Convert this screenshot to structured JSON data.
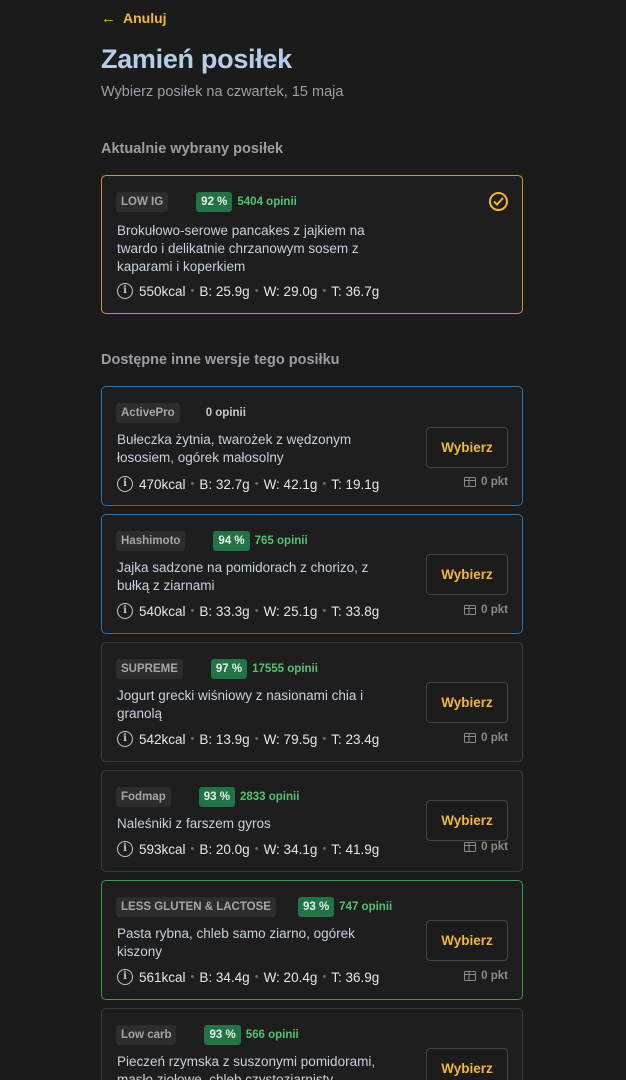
{
  "nav": {
    "back_label": "Anuluj"
  },
  "header": {
    "title": "Zamień posiłek",
    "subtitle": "Wybierz posiłek na czwartek, 15 maja"
  },
  "current_section": {
    "label": "Aktualnie wybrany posiłek",
    "meal": {
      "tag": "LOW IG",
      "rating": "92 %",
      "opinions": "5404 opinii",
      "name": "Brokułowo-serowe pancakes z jajkiem na twardo i delikatnie chrzanowym sosem z kaparami i koperkiem",
      "kcal": "550kcal",
      "protein": "B: 25.9g",
      "carbs": "W: 29.0g",
      "fat": "T: 36.7g"
    }
  },
  "alternatives_section": {
    "label": "Dostępne inne wersje tego posiłku",
    "choose_label": "Wybierz",
    "items": [
      {
        "tag": "ActivePro",
        "rating": "",
        "opinions": "0 opinii",
        "name": "Bułeczka żytnia, twarożek z wędzonym łososiem, ogórek małosolny",
        "kcal": "470kcal",
        "protein": "B: 32.7g",
        "carbs": "W: 42.1g",
        "fat": "T: 19.1g",
        "points": "0 pkt"
      },
      {
        "tag": "Hashimoto",
        "rating": "94 %",
        "opinions": "765 opinii",
        "name": "Jajka sadzone na pomidorach z chorizo, z bułką z ziarnami",
        "kcal": "540kcal",
        "protein": "B: 33.3g",
        "carbs": "W: 25.1g",
        "fat": "T: 33.8g",
        "points": "0 pkt"
      },
      {
        "tag": "SUPREME",
        "rating": "97 %",
        "opinions": "17555 opinii",
        "name": "Jogurt grecki wiśniowy z nasionami chia i granolą",
        "kcal": "542kcal",
        "protein": "B: 13.9g",
        "carbs": "W: 79.5g",
        "fat": "T: 23.4g",
        "points": "0 pkt"
      },
      {
        "tag": "Fodmap",
        "rating": "93 %",
        "opinions": "2833 opinii",
        "name": "Naleśniki z farszem gyros",
        "kcal": "593kcal",
        "protein": "B: 20.0g",
        "carbs": "W: 34.1g",
        "fat": "T: 41.9g",
        "points": "0 pkt"
      },
      {
        "tag": "LESS GLUTEN & LACTOSE",
        "rating": "93 %",
        "opinions": "747 opinii",
        "name": "Pasta rybna, chleb samo ziarno, ogórek kiszony",
        "kcal": "561kcal",
        "protein": "B: 34.4g",
        "carbs": "W: 20.4g",
        "fat": "T: 36.9g",
        "points": "0 pkt"
      },
      {
        "tag": "Low carb",
        "rating": "93 %",
        "opinions": "566 opinii",
        "name": "Pieczeń rzymska z suszonymi pomidorami, masło ziołowe, chleb czystoziarnisty, papryka",
        "kcal": "",
        "protein": "",
        "carbs": "",
        "fat": "",
        "points": ""
      }
    ]
  },
  "colors": {
    "accent": "#f2b733",
    "background": "#1b1b1b",
    "rating_bg": "#227447",
    "opinions": "#52c36e",
    "border_selected": "#c59a35",
    "border_blue": "#2775b2",
    "border_green": "#3c9a49"
  },
  "icons": {
    "back": "arrow-left-icon",
    "selected": "check-circle-icon",
    "info": "info-icon",
    "points": "wallet-icon"
  }
}
